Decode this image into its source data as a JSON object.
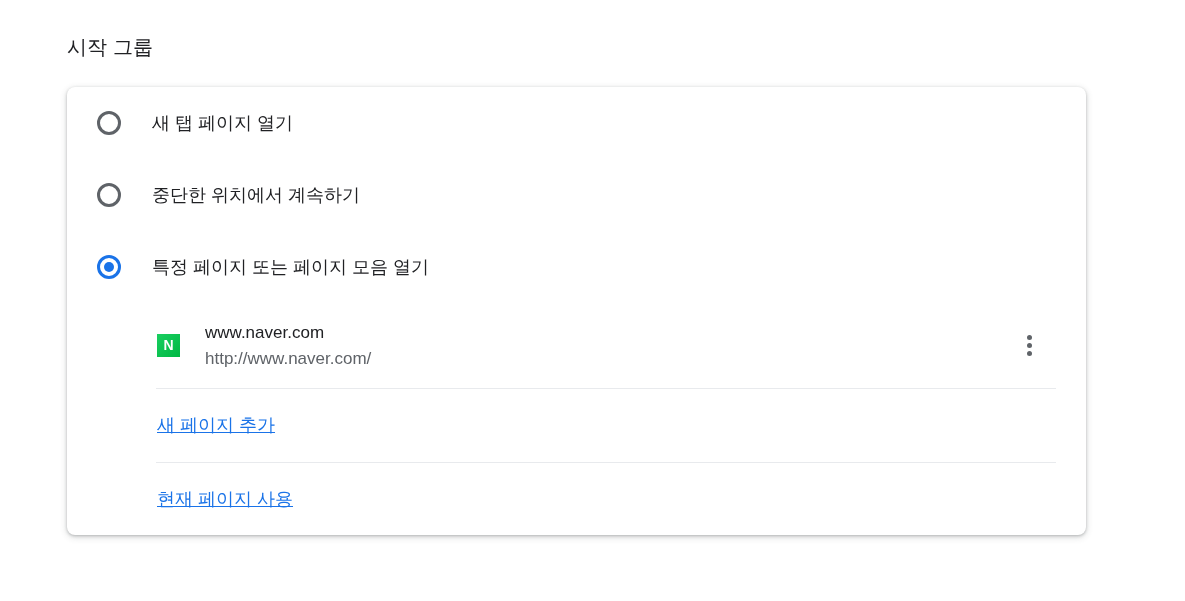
{
  "section": {
    "title": "시작 그룹"
  },
  "options": [
    {
      "label": "새 탭 페이지 열기",
      "selected": false
    },
    {
      "label": "중단한 위치에서 계속하기",
      "selected": false
    },
    {
      "label": "특정 페이지 또는 페이지 모음 열기",
      "selected": true
    }
  ],
  "pages": [
    {
      "favicon_text": "N",
      "title": "www.naver.com",
      "url": "http://www.naver.com/"
    }
  ],
  "links": [
    "새 페이지 추가",
    "현재 페이지 사용"
  ]
}
